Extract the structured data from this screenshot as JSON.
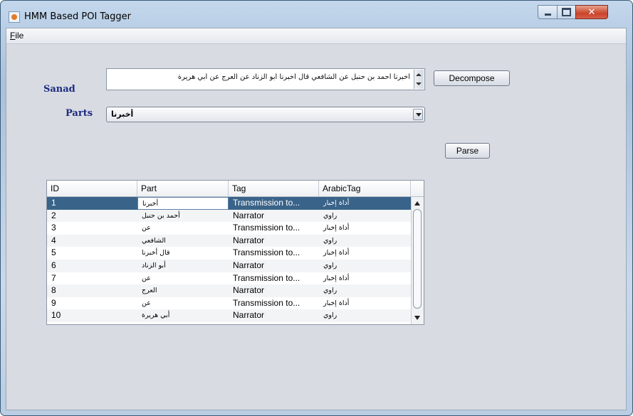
{
  "window": {
    "title": "HMM Based POI Tagger"
  },
  "menu": {
    "file_accel": "F",
    "file_rest": "ile"
  },
  "sanad": {
    "label": "Sanad",
    "value": "أخبرنا أحمد بن حنبل عن الشافعي قال أخبرنا أبو الزناد عن العرج عن أبي هريرة",
    "decompose_label": "Decompose"
  },
  "parts": {
    "label": "Parts",
    "selected": "أخبرنا"
  },
  "parse_label": "Parse",
  "table": {
    "columns": [
      "ID",
      "Part",
      "Tag",
      "ArabicTag"
    ],
    "selected_row": 0,
    "rows": [
      [
        "1",
        "أخبرنا",
        "Transmission to...",
        "أداة إخبار"
      ],
      [
        "2",
        "أحمد بن حنبل",
        "Narrator",
        "راوي"
      ],
      [
        "3",
        "عن",
        "Transmission to...",
        "أداة إخبار"
      ],
      [
        "4",
        "الشافعي",
        "Narrator",
        "راوي"
      ],
      [
        "5",
        "قال أخبرنا",
        "Transmission to...",
        "أداة إخبار"
      ],
      [
        "6",
        "أبو الزناد",
        "Narrator",
        "راوي"
      ],
      [
        "7",
        "عن",
        "Transmission to...",
        "أداة إخبار"
      ],
      [
        "8",
        "العرج",
        "Narrator",
        "راوي"
      ],
      [
        "9",
        "عن",
        "Transmission to...",
        "أداة إخبار"
      ],
      [
        "10",
        "أبي هريرة",
        "Narrator",
        "راوي"
      ]
    ]
  }
}
